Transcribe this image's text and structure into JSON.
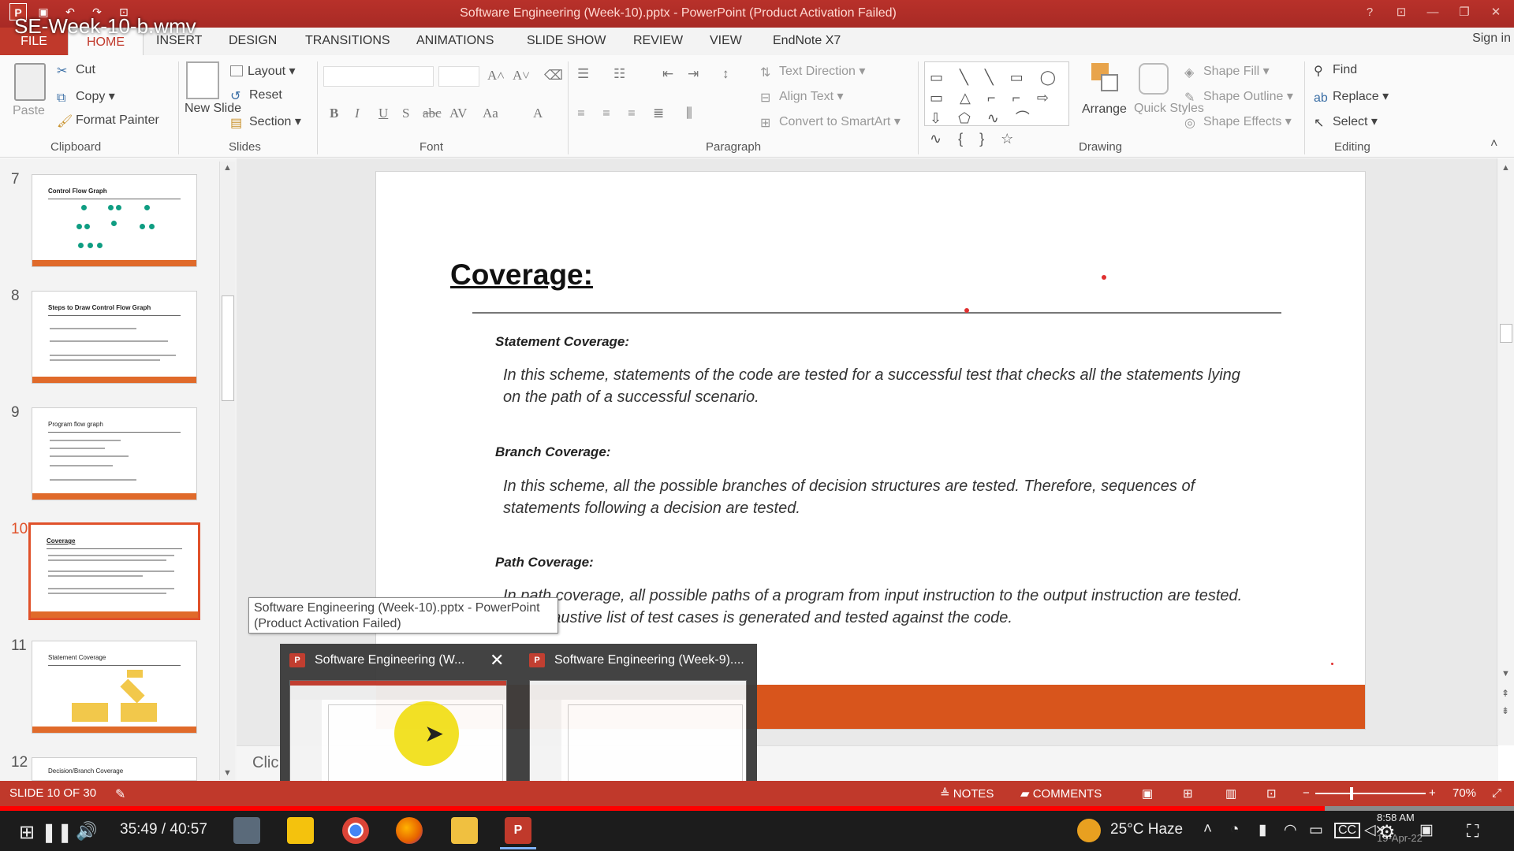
{
  "video": {
    "title": "SE-Week-10-b.wmv",
    "time": "35:49 / 40:57",
    "progress_percent": 87.5
  },
  "window": {
    "title": "Software Engineering (Week-10).pptx - PowerPoint (Product Activation Failed)",
    "sign_in": "Sign in"
  },
  "ribbon": {
    "tabs": [
      "FILE",
      "HOME",
      "INSERT",
      "DESIGN",
      "TRANSITIONS",
      "ANIMATIONS",
      "SLIDE SHOW",
      "REVIEW",
      "VIEW",
      "EndNote X7"
    ],
    "clipboard": {
      "paste": "Paste",
      "cut": "Cut",
      "copy": "Copy",
      "format_painter": "Format Painter",
      "label": "Clipboard"
    },
    "slides": {
      "new_slide": "New Slide",
      "layout": "Layout",
      "reset": "Reset",
      "section": "Section",
      "label": "Slides"
    },
    "font": {
      "label": "Font"
    },
    "paragraph": {
      "text_direction": "Text Direction",
      "align_text": "Align Text",
      "convert_smartart": "Convert to SmartArt",
      "label": "Paragraph"
    },
    "drawing": {
      "arrange": "Arrange",
      "quick_styles": "Quick Styles",
      "shape_fill": "Shape Fill",
      "shape_outline": "Shape Outline",
      "shape_effects": "Shape Effects",
      "label": "Drawing"
    },
    "editing": {
      "find": "Find",
      "replace": "Replace",
      "select": "Select",
      "label": "Editing"
    }
  },
  "thumbnails": [
    {
      "num": "7",
      "title": "Control Flow Graph"
    },
    {
      "num": "8",
      "title": "Steps to Draw Control Flow Graph"
    },
    {
      "num": "9",
      "title": "Program flow graph"
    },
    {
      "num": "10",
      "title": "Coverage"
    },
    {
      "num": "11",
      "title": "Statement Coverage"
    },
    {
      "num": "12",
      "title": "Decision/Branch Coverage"
    }
  ],
  "slide": {
    "title": "Coverage:",
    "sections": [
      {
        "heading": "Statement Coverage:",
        "text": "In this scheme, statements of the code are tested for a successful test that checks all the statements lying on the path of a successful scenario."
      },
      {
        "heading": "Branch Coverage:",
        "text": "In this scheme, all the possible branches of decision structures are tested. Therefore, sequences of statements following a decision are tested."
      },
      {
        "heading": "Path Coverage:",
        "text": "In path coverage, all possible paths of a program from input instruction to the output instruction are tested. An exhaustive list of test cases is generated and tested against the code."
      }
    ]
  },
  "notes_hint": "Clic",
  "tooltip": "Software Engineering (Week-10).pptx - PowerPoint (Product Activation Failed)",
  "preview": {
    "item1": "Software Engineering (W...",
    "item2": "Software Engineering (Week-9)...."
  },
  "statusbar": {
    "slide": "SLIDE 10 OF 30",
    "notes": "NOTES",
    "comments": "COMMENTS",
    "zoom": "70%"
  },
  "taskbar": {
    "weather": "25°C  Haze",
    "clock": "8:58 AM",
    "date": "19-Apr-22"
  },
  "colors": {
    "accent": "#c0392b",
    "slide_bar": "#d8551c"
  }
}
